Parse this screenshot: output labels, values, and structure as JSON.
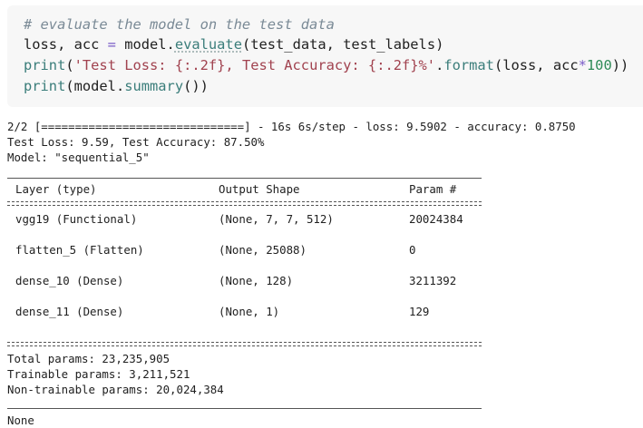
{
  "code": {
    "line1_comment": "# evaluate the model on the test data",
    "line2": {
      "lhs": "loss, acc ",
      "eq": "=",
      "obj": " model.",
      "method": "evaluate",
      "args": "(test_data, test_labels)"
    },
    "line3": {
      "fn": "print",
      "open": "(",
      "str": "'Test Loss: {:.2f}, Test Accuracy: {:.2f}%'",
      "dot": ".",
      "format_fn": "format",
      "args_a": "(loss, acc",
      "star": "*",
      "num": "100",
      "close": "))"
    },
    "line4": {
      "fn": "print",
      "open": "(model.",
      "method": "summary",
      "close": "())"
    }
  },
  "output": {
    "progress": "2/2 [==============================] - 16s 6s/step - loss: 9.5902 - accuracy: 0.8750",
    "test_line": "Test Loss: 9.59, Test Accuracy: 87.50%",
    "model_line": "Model: \"sequential_5\"",
    "headers": [
      "Layer (type)",
      "Output Shape",
      "Param #"
    ],
    "rows": [
      [
        "vgg19 (Functional)",
        "(None, 7, 7, 512)",
        "20024384"
      ],
      [
        "flatten_5 (Flatten)",
        "(None, 25088)",
        "0"
      ],
      [
        "dense_10 (Dense)",
        "(None, 128)",
        "3211392"
      ],
      [
        "dense_11 (Dense)",
        "(None, 1)",
        "129"
      ]
    ],
    "total_params": "Total params: 23,235,905",
    "trainable_params": "Trainable params: 3,211,521",
    "non_trainable_params": "Non-trainable params: 20,024,384",
    "final": "None"
  }
}
